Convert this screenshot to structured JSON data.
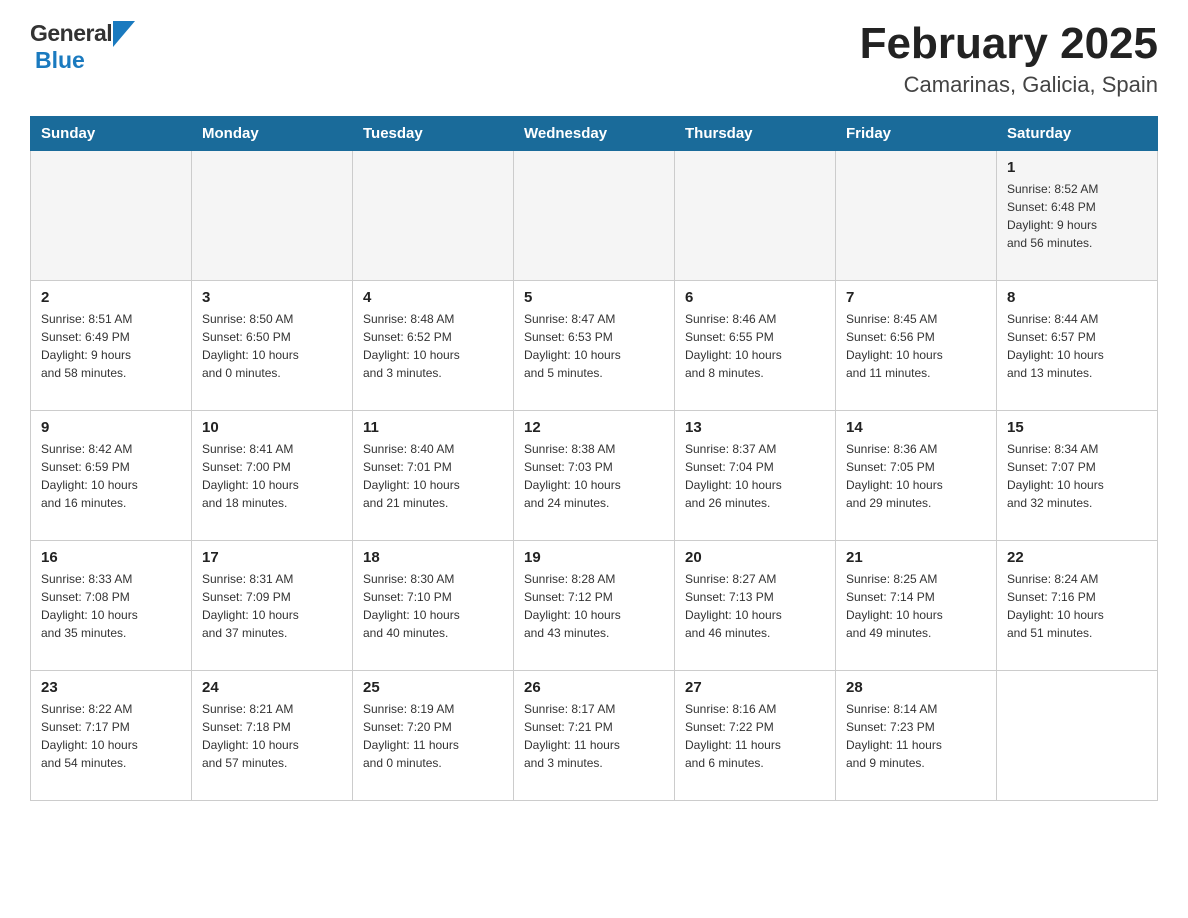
{
  "header": {
    "title": "February 2025",
    "subtitle": "Camarinas, Galicia, Spain",
    "logo_general": "General",
    "logo_blue": "Blue"
  },
  "weekdays": [
    "Sunday",
    "Monday",
    "Tuesday",
    "Wednesday",
    "Thursday",
    "Friday",
    "Saturday"
  ],
  "weeks": [
    {
      "days": [
        {
          "number": "",
          "info": ""
        },
        {
          "number": "",
          "info": ""
        },
        {
          "number": "",
          "info": ""
        },
        {
          "number": "",
          "info": ""
        },
        {
          "number": "",
          "info": ""
        },
        {
          "number": "",
          "info": ""
        },
        {
          "number": "1",
          "info": "Sunrise: 8:52 AM\nSunset: 6:48 PM\nDaylight: 9 hours\nand 56 minutes."
        }
      ]
    },
    {
      "days": [
        {
          "number": "2",
          "info": "Sunrise: 8:51 AM\nSunset: 6:49 PM\nDaylight: 9 hours\nand 58 minutes."
        },
        {
          "number": "3",
          "info": "Sunrise: 8:50 AM\nSunset: 6:50 PM\nDaylight: 10 hours\nand 0 minutes."
        },
        {
          "number": "4",
          "info": "Sunrise: 8:48 AM\nSunset: 6:52 PM\nDaylight: 10 hours\nand 3 minutes."
        },
        {
          "number": "5",
          "info": "Sunrise: 8:47 AM\nSunset: 6:53 PM\nDaylight: 10 hours\nand 5 minutes."
        },
        {
          "number": "6",
          "info": "Sunrise: 8:46 AM\nSunset: 6:55 PM\nDaylight: 10 hours\nand 8 minutes."
        },
        {
          "number": "7",
          "info": "Sunrise: 8:45 AM\nSunset: 6:56 PM\nDaylight: 10 hours\nand 11 minutes."
        },
        {
          "number": "8",
          "info": "Sunrise: 8:44 AM\nSunset: 6:57 PM\nDaylight: 10 hours\nand 13 minutes."
        }
      ]
    },
    {
      "days": [
        {
          "number": "9",
          "info": "Sunrise: 8:42 AM\nSunset: 6:59 PM\nDaylight: 10 hours\nand 16 minutes."
        },
        {
          "number": "10",
          "info": "Sunrise: 8:41 AM\nSunset: 7:00 PM\nDaylight: 10 hours\nand 18 minutes."
        },
        {
          "number": "11",
          "info": "Sunrise: 8:40 AM\nSunset: 7:01 PM\nDaylight: 10 hours\nand 21 minutes."
        },
        {
          "number": "12",
          "info": "Sunrise: 8:38 AM\nSunset: 7:03 PM\nDaylight: 10 hours\nand 24 minutes."
        },
        {
          "number": "13",
          "info": "Sunrise: 8:37 AM\nSunset: 7:04 PM\nDaylight: 10 hours\nand 26 minutes."
        },
        {
          "number": "14",
          "info": "Sunrise: 8:36 AM\nSunset: 7:05 PM\nDaylight: 10 hours\nand 29 minutes."
        },
        {
          "number": "15",
          "info": "Sunrise: 8:34 AM\nSunset: 7:07 PM\nDaylight: 10 hours\nand 32 minutes."
        }
      ]
    },
    {
      "days": [
        {
          "number": "16",
          "info": "Sunrise: 8:33 AM\nSunset: 7:08 PM\nDaylight: 10 hours\nand 35 minutes."
        },
        {
          "number": "17",
          "info": "Sunrise: 8:31 AM\nSunset: 7:09 PM\nDaylight: 10 hours\nand 37 minutes."
        },
        {
          "number": "18",
          "info": "Sunrise: 8:30 AM\nSunset: 7:10 PM\nDaylight: 10 hours\nand 40 minutes."
        },
        {
          "number": "19",
          "info": "Sunrise: 8:28 AM\nSunset: 7:12 PM\nDaylight: 10 hours\nand 43 minutes."
        },
        {
          "number": "20",
          "info": "Sunrise: 8:27 AM\nSunset: 7:13 PM\nDaylight: 10 hours\nand 46 minutes."
        },
        {
          "number": "21",
          "info": "Sunrise: 8:25 AM\nSunset: 7:14 PM\nDaylight: 10 hours\nand 49 minutes."
        },
        {
          "number": "22",
          "info": "Sunrise: 8:24 AM\nSunset: 7:16 PM\nDaylight: 10 hours\nand 51 minutes."
        }
      ]
    },
    {
      "days": [
        {
          "number": "23",
          "info": "Sunrise: 8:22 AM\nSunset: 7:17 PM\nDaylight: 10 hours\nand 54 minutes."
        },
        {
          "number": "24",
          "info": "Sunrise: 8:21 AM\nSunset: 7:18 PM\nDaylight: 10 hours\nand 57 minutes."
        },
        {
          "number": "25",
          "info": "Sunrise: 8:19 AM\nSunset: 7:20 PM\nDaylight: 11 hours\nand 0 minutes."
        },
        {
          "number": "26",
          "info": "Sunrise: 8:17 AM\nSunset: 7:21 PM\nDaylight: 11 hours\nand 3 minutes."
        },
        {
          "number": "27",
          "info": "Sunrise: 8:16 AM\nSunset: 7:22 PM\nDaylight: 11 hours\nand 6 minutes."
        },
        {
          "number": "28",
          "info": "Sunrise: 8:14 AM\nSunset: 7:23 PM\nDaylight: 11 hours\nand 9 minutes."
        },
        {
          "number": "",
          "info": ""
        }
      ]
    }
  ]
}
